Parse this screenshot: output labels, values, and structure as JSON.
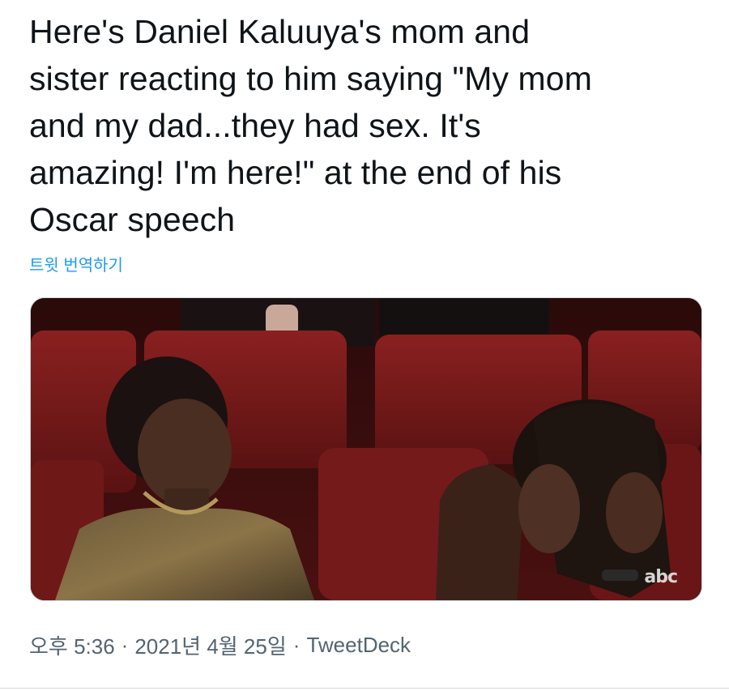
{
  "tweet": {
    "text": "Here's Daniel Kaluuya's mom and\nsister reacting to him saying \"My mom\nand my dad...they had sex. It's\namazing! I'm here!\" at the end of his\nOscar speech",
    "translate_label": "트윗 번역하기"
  },
  "media": {
    "watermark": "abc",
    "description_icon": "video-still"
  },
  "meta": {
    "time": "오후 5:36",
    "separator": "·",
    "date": "2021년 4월 25일",
    "source": "TweetDeck"
  },
  "colors": {
    "link": "#1d9bf0",
    "meta_text": "#536471",
    "seat_red": "#7a1a1a"
  }
}
